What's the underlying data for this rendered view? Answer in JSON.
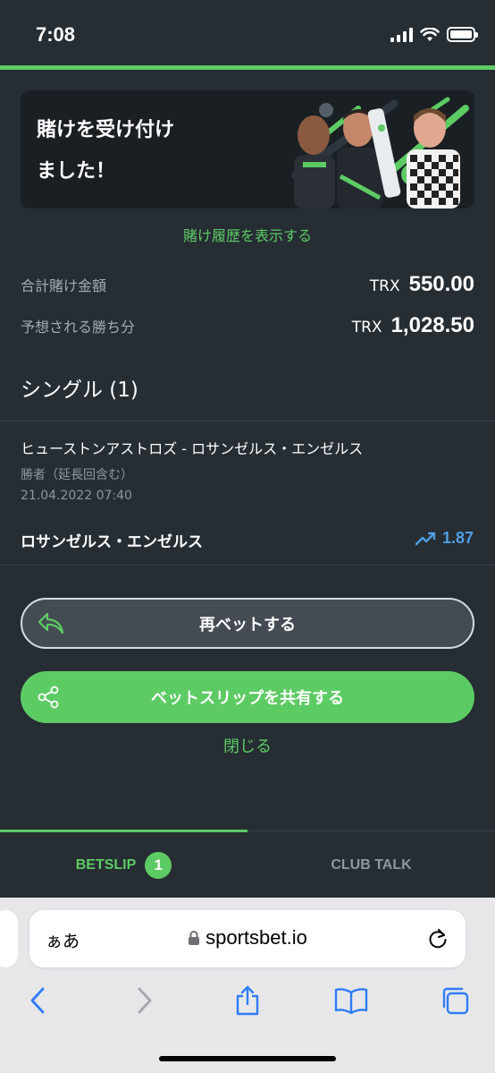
{
  "status_bar": {
    "time": "7:08"
  },
  "banner": {
    "title": "賭けを受け付けました！"
  },
  "history_link": "賭け履歴を表示する",
  "summary": {
    "total_stake_label": "合計賭け金額",
    "total_stake_currency": "TRX",
    "total_stake_amount": "550.00",
    "expected_win_label": "予想される勝ち分",
    "expected_win_currency": "TRX",
    "expected_win_amount": "1,028.50"
  },
  "section_title": "シングル (1)",
  "bet": {
    "event": "ヒューストンアストロズ - ロサンゼルス・エンゼルス",
    "market": "勝者（延長回含む）",
    "date": "21.04.2022 07:40",
    "selection": "ロサンゼルス・エンゼルス",
    "odds": "1.87"
  },
  "buttons": {
    "rebet": "再ベットする",
    "share": "ベットスリップを共有する",
    "close": "閉じる"
  },
  "tabs": {
    "betslip": "BETSLIP",
    "betslip_count": "1",
    "club_talk": "CLUB TALK"
  },
  "browser": {
    "text_size_button": "ぁあ",
    "url": "sportsbet.io"
  },
  "colors": {
    "background": "#262d33",
    "accent_green": "#5dcb64",
    "odds_blue": "#4f9fe3"
  }
}
